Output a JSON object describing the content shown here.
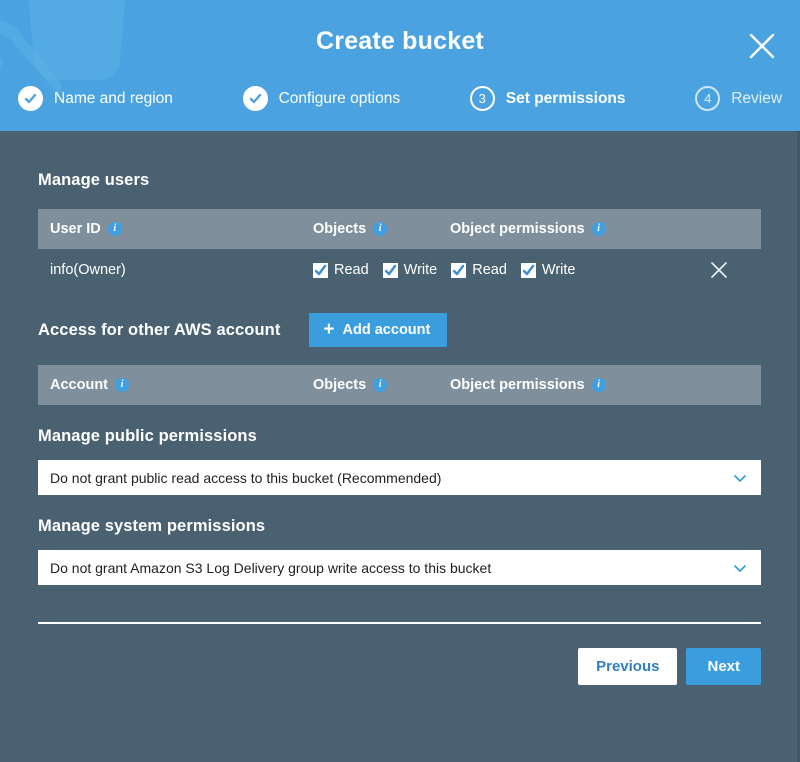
{
  "header": {
    "title": "Create bucket",
    "close_label": "Close",
    "close_icon": "close-icon",
    "watermark_icon": "bucket-watermark-icon",
    "background_color": "#4aa3e0",
    "steps": [
      {
        "number": "1",
        "label": "Name and region",
        "state": "done"
      },
      {
        "number": "2",
        "label": "Configure options",
        "state": "done"
      },
      {
        "number": "3",
        "label": "Set permissions",
        "state": "current"
      },
      {
        "number": "4",
        "label": "Review",
        "state": "future"
      }
    ]
  },
  "body": {
    "background_color": "#4a6172",
    "manage_users": {
      "title": "Manage users",
      "columns": [
        {
          "label": "User ID",
          "info_icon": "info-icon"
        },
        {
          "label": "Objects",
          "info_icon": "info-icon"
        },
        {
          "label": "Object permissions",
          "info_icon": "info-icon"
        }
      ],
      "rows": [
        {
          "user": "info(Owner)",
          "objects": [
            {
              "label": "Read",
              "checked": true
            },
            {
              "label": "Write",
              "checked": true
            }
          ],
          "object_permissions": [
            {
              "label": "Read",
              "checked": true
            },
            {
              "label": "Write",
              "checked": true
            }
          ],
          "remove_icon": "close-icon"
        }
      ]
    },
    "other_account": {
      "title": "Access for other AWS account",
      "add_button_label": "Add account",
      "add_button_icon": "plus-icon",
      "columns": [
        {
          "label": "Account",
          "info_icon": "info-icon"
        },
        {
          "label": "Objects",
          "info_icon": "info-icon"
        },
        {
          "label": "Object permissions",
          "info_icon": "info-icon"
        }
      ],
      "rows": []
    },
    "public_permissions": {
      "title": "Manage public permissions",
      "selected": "Do not grant public read access to this bucket (Recommended)",
      "caret_icon": "chevron-down-icon"
    },
    "system_permissions": {
      "title": "Manage system permissions",
      "selected": "Do not grant Amazon S3 Log Delivery group write access to this bucket",
      "caret_icon": "chevron-down-icon"
    }
  },
  "footer": {
    "previous_label": "Previous",
    "next_label": "Next",
    "accent_color": "#3a9ddd"
  }
}
